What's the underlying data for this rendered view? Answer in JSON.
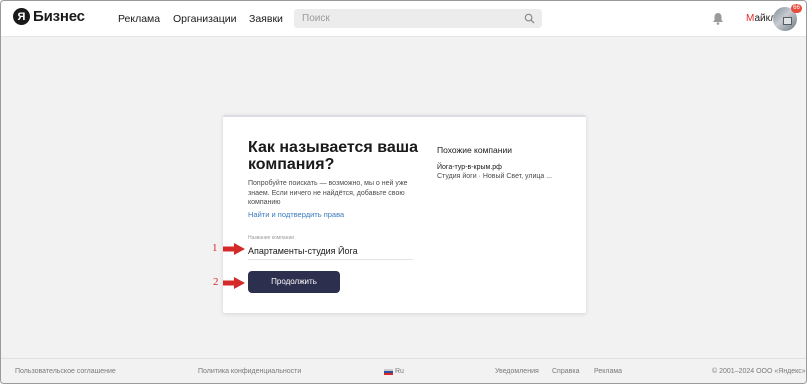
{
  "header": {
    "logo_letter": "Я",
    "logo_text": "Бизнес",
    "nav": [
      "Реклама",
      "Организации",
      "Заявки"
    ],
    "search_placeholder": "Поиск",
    "user_name_first": "М",
    "user_name_rest": "айкл",
    "notifications_badge": "66"
  },
  "card": {
    "title": "Как называется ваша компания?",
    "description": "Попробуйте поискать — возможно, мы о ней уже знаем. Если ничего не найдётся, добавьте свою компанию",
    "link": "Найти и подтвердить права",
    "field_label": "Название компании",
    "field_value": "Апартаменты-студия Йога",
    "continue_label": "Продолжить",
    "similar": {
      "title": "Похожие компании",
      "name": "Йога-тур-в-крым.рф",
      "description": "Студия йоги · Новый Свет, улица ..."
    }
  },
  "annotations": {
    "first": "1",
    "second": "2"
  },
  "footer": {
    "agreement": "Пользовательское соглашение",
    "privacy": "Политика конфиденциальности",
    "lang": "Ru",
    "notifications": "Уведомления",
    "help": "Справка",
    "ads": "Реклама",
    "copyright": "© 2001–2024 ООО «Яндекс»"
  },
  "colors": {
    "brand_dark": "#2d2f4e",
    "link": "#3a7bbf",
    "annotation_red": "#d42a2a",
    "badge": "#e64d3d"
  }
}
